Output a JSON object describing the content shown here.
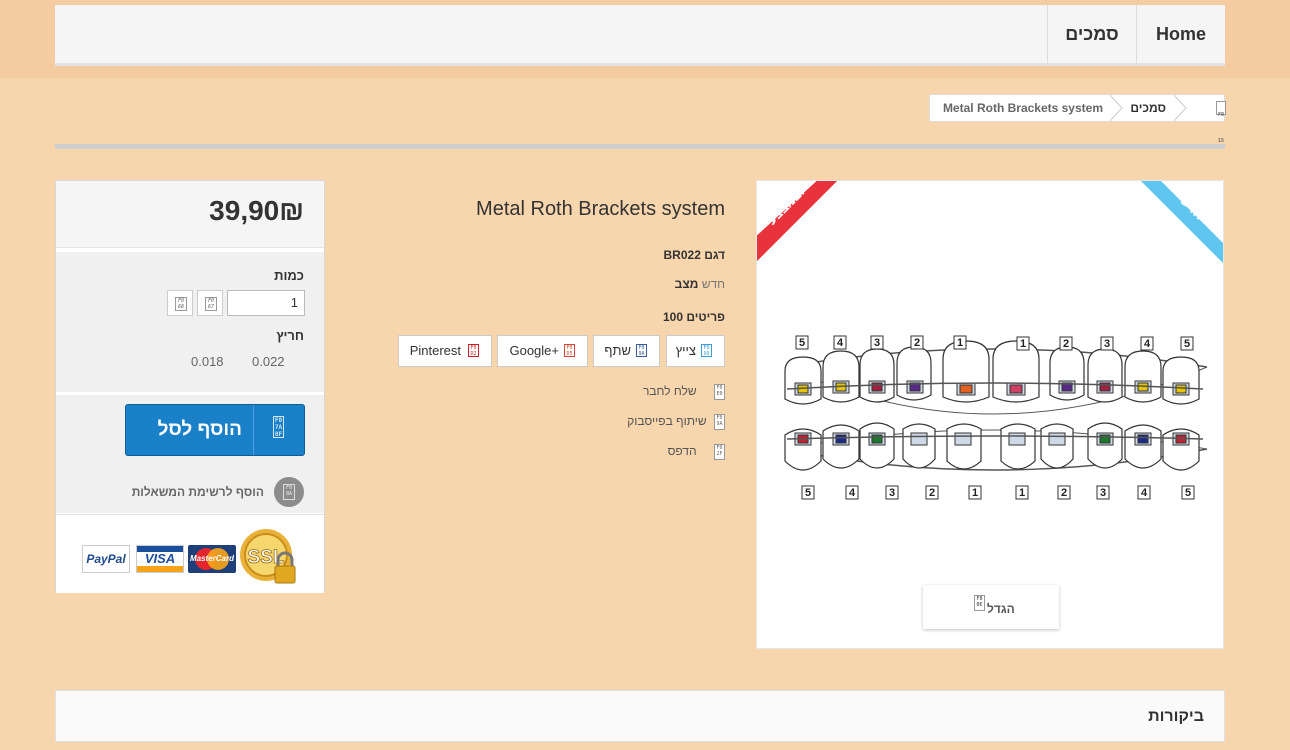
{
  "nav": {
    "home": "Home",
    "category": "סמכים"
  },
  "breadcrumb": {
    "category": "סמכים",
    "current": "Metal Roth Brackets system"
  },
  "buy_box": {
    "price": "39,90₪",
    "quantity_label": "כמות",
    "quantity_value": "1",
    "slot_label": "חריץ",
    "slot_options": [
      "0.022",
      "0.018"
    ],
    "add_to_cart": "הוסף לסל",
    "wishlist": "הוסף לרשימת המשאלות",
    "payment_logos": [
      "SSL",
      "MasterCard",
      "VISA",
      "PayPal"
    ]
  },
  "product": {
    "title": "Metal Roth Brackets system",
    "model_label": "דגם",
    "model_value": "BR022",
    "condition_label": "מצב",
    "condition_value": "חדש",
    "stock": "100 פריטים",
    "share_buttons": [
      "צייץ",
      "שתף",
      "Google+",
      "Pinterest"
    ],
    "links": [
      "שלח לחבר",
      "שיתוף בפייסבוק",
      "הדפס"
    ]
  },
  "image": {
    "ribbon_new": "חדש",
    "ribbon_sale": "במבצע!",
    "enlarge": "הגדל",
    "tooth_numbers": [
      "5",
      "4",
      "3",
      "2",
      "1",
      "1",
      "2",
      "3",
      "4",
      "5"
    ]
  },
  "reviews": {
    "title": "ביקורות"
  },
  "colors": {
    "background": "#f7d5ad",
    "cart_button": "#1a80c8",
    "ribbon_new": "#5ec6ef",
    "ribbon_sale": "#e8323c"
  }
}
